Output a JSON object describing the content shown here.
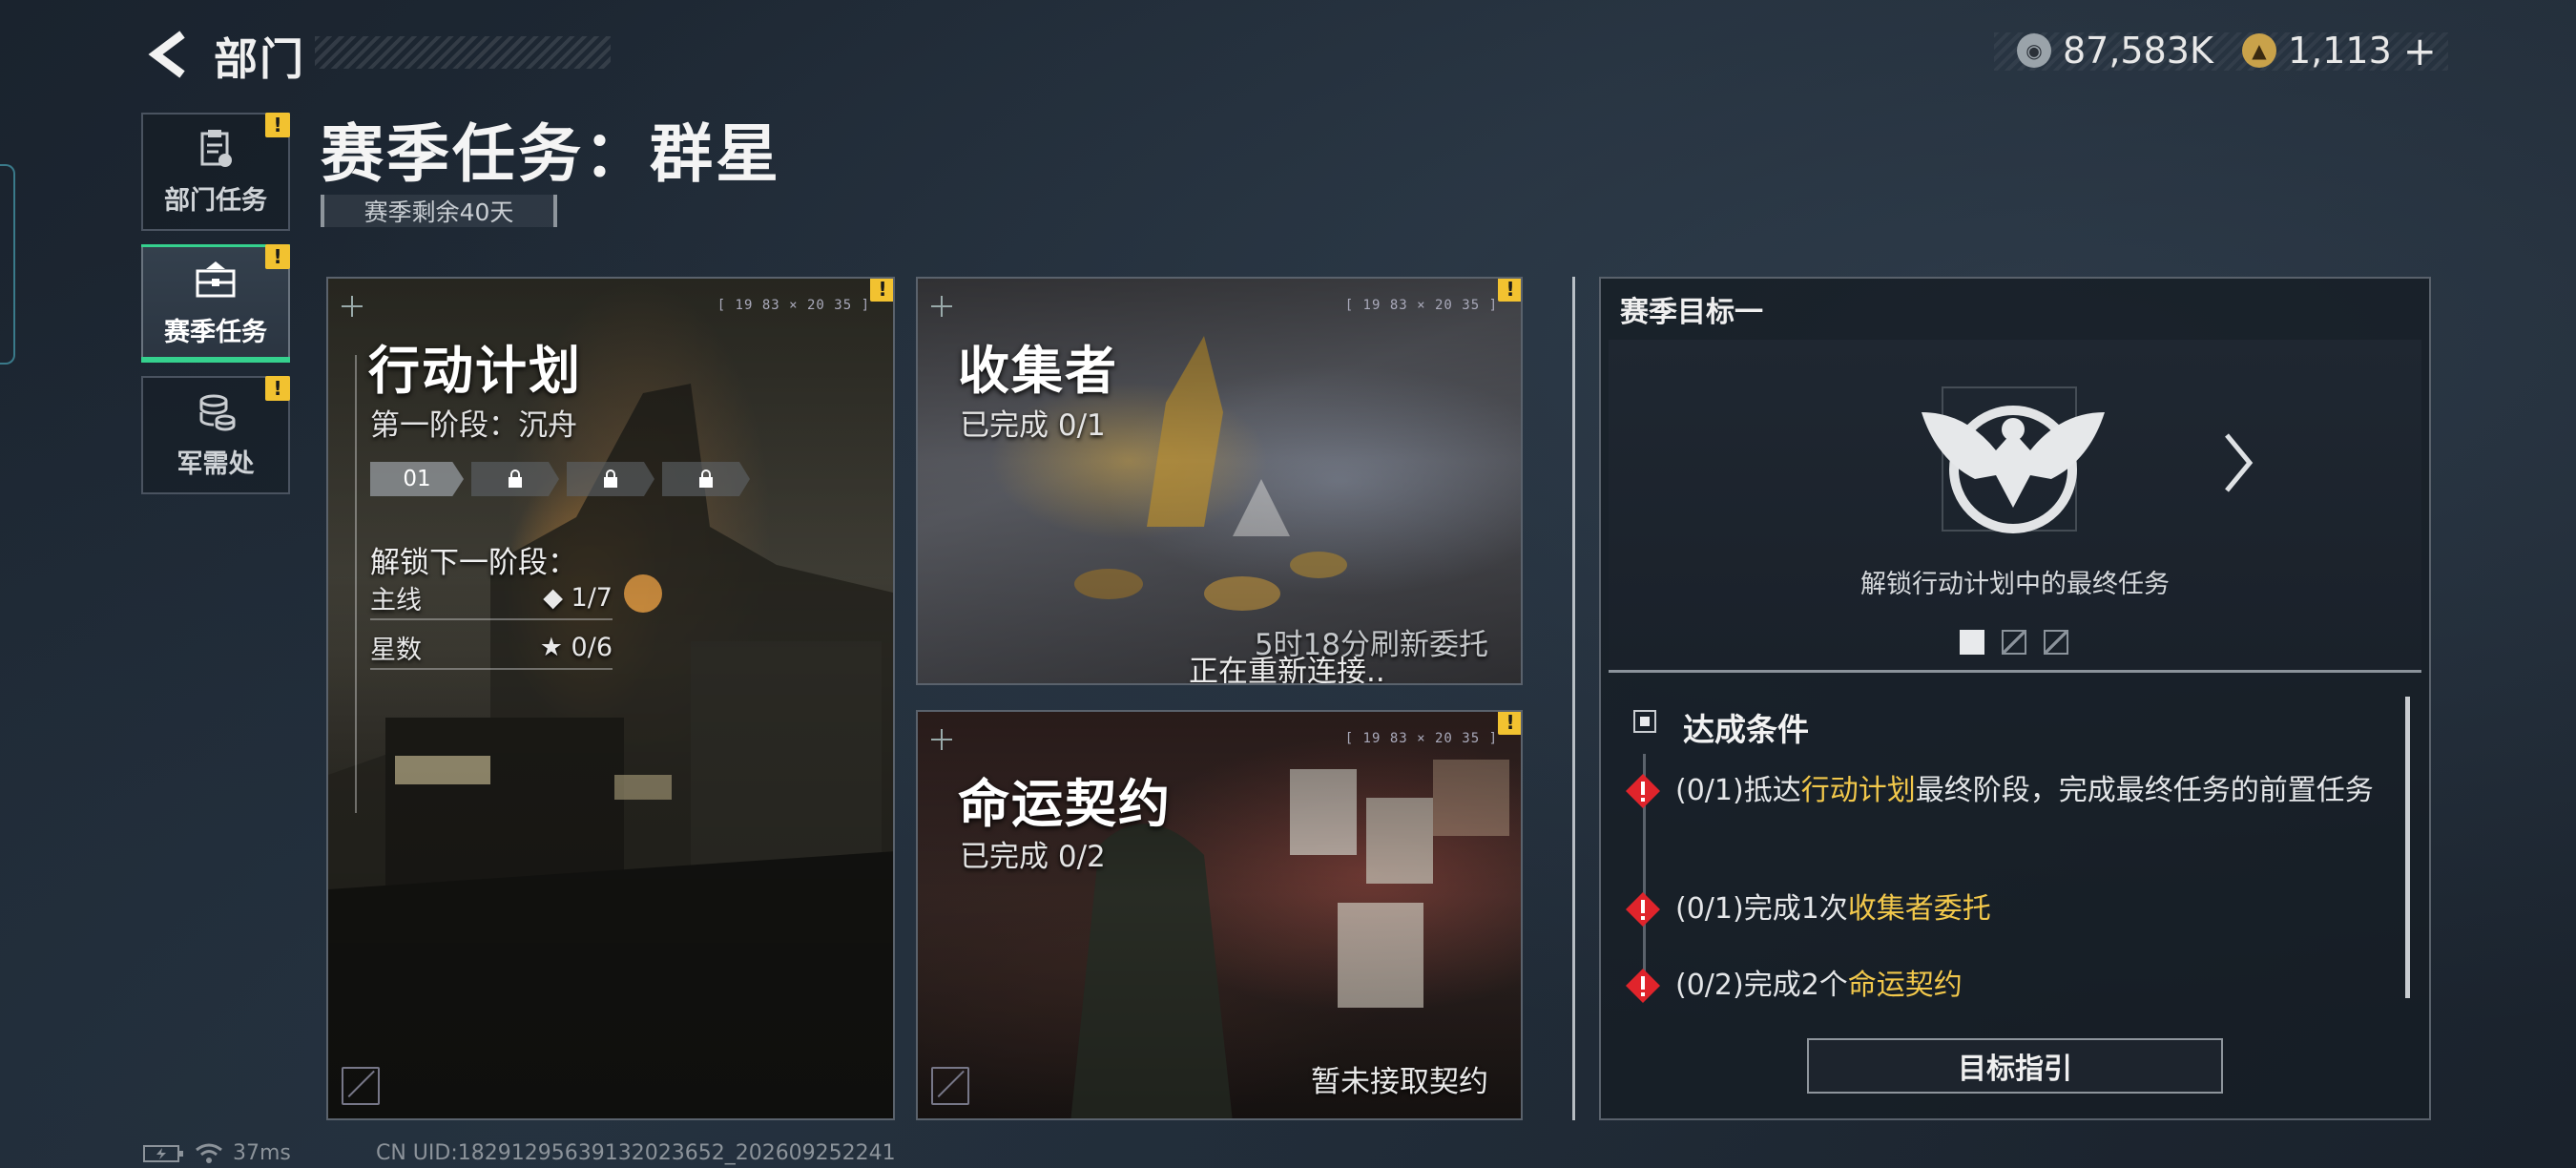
{
  "header": {
    "back_label": "部门",
    "page_title": "赛季任务：群星",
    "season_remaining": "赛季剩余40天"
  },
  "currency": {
    "coin_value": "87,583K",
    "ticket_value": "1,113",
    "ticket_plus": "+"
  },
  "sidebar": {
    "items": [
      {
        "label": "部门任务",
        "icon": "clipboard-icon",
        "warning": "!",
        "active": false
      },
      {
        "label": "赛季任务",
        "icon": "briefcase-icon",
        "warning": "!",
        "active": true
      },
      {
        "label": "军需处",
        "icon": "coins-icon",
        "warning": "!",
        "active": false
      }
    ]
  },
  "cards": {
    "action": {
      "title": "行动计划",
      "phase": "第一阶段：沉舟",
      "stage_current": "01",
      "unlock_label": "解锁下一阶段：",
      "rows": [
        {
          "label": "主线",
          "value": "◆ 1/7"
        },
        {
          "label": "星数",
          "value": "★ 0/6"
        }
      ],
      "hud": "[ 19 83  ×  20 35 ]",
      "warning": "!"
    },
    "collector": {
      "title": "收集者",
      "progress": "已完成 0/1",
      "refresh": "5时18分刷新委托",
      "reconnect": "正在重新连接..",
      "hud": "[ 19 83  ×  20 35 ]",
      "warning": "!"
    },
    "fate": {
      "title": "命运契约",
      "progress": "已完成 0/2",
      "status": "暂未接取契约",
      "hud": "[ 19 83  ×  20 35 ]",
      "warning": "!"
    }
  },
  "panel": {
    "title": "赛季目标一",
    "emblem_caption": "解锁行动计划中的最终任务",
    "conditions_header": "达成条件",
    "conditions": [
      {
        "pre": "(0/1)抵达",
        "hl": "行动计划",
        "post": "最终阶段，完成最终任务的前置任务"
      },
      {
        "pre": "(0/1)完成1次",
        "hl": "收集者委托",
        "post": ""
      },
      {
        "pre": "(0/2)完成2个",
        "hl": "命运契约",
        "post": ""
      }
    ],
    "guide_button": "目标指引",
    "page_dots": 3,
    "active_dot": 0
  },
  "status": {
    "ping": "37ms",
    "uid": "CN UID:18291295639132023652_202609252241"
  },
  "colors": {
    "accent_green": "#35d18e",
    "warning_yellow": "#f2c230",
    "highlight_yellow": "#f2c84b",
    "alert_red": "#e0242b"
  }
}
